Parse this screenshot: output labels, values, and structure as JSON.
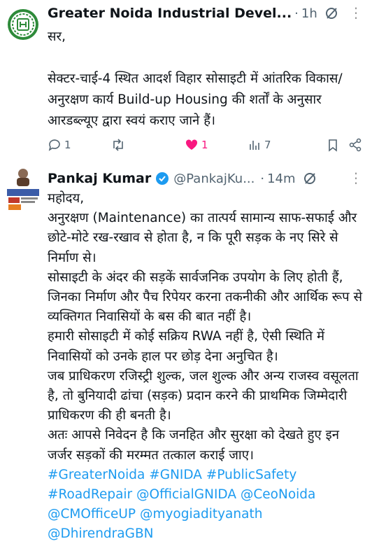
{
  "tweet1": {
    "author": "Greater Noida Industrial Devel...",
    "time": "1h",
    "greeting": "सर,",
    "body": "सेक्टर-चाई-4 स्थित आदर्श विहार सोसाइटी में आंतरिक विकास/अनुरक्षण कार्य Build-up Housing की शर्तों के अनुसार आरडब्ल्यूए द्वारा स्वयं कराए जाने हैं।",
    "actions": {
      "replies": "1",
      "reposts": "",
      "likes": "1",
      "views": "7"
    },
    "colors": {
      "avatar_green": "#2e8b3a",
      "like": "#f91880"
    }
  },
  "tweet2": {
    "author": "Pankaj Kumar",
    "handle": "@PankajKu...",
    "dot": "·",
    "time": "14m",
    "paragraphs": [
      "महोदय,",
      "अनुरक्षण (Maintenance) का तात्पर्य सामान्य साफ-सफाई और छोटे-मोटे रख-रखाव से होता है, न कि पूरी सड़क के नए सिरे से निर्माण से।",
      "सोसाइटी के अंदर की सड़कें सार्वजनिक उपयोग के लिए होती हैं, जिनका निर्माण और पैच रिपेयर करना तकनीकी और आर्थिक रूप से व्यक्तिगत निवासियों के बस की बात नहीं है।",
      "हमारी सोसाइटी में कोई सक्रिय RWA नहीं है, ऐसी स्थिति में निवासियों को उनके हाल पर छोड़ देना अनुचित है।",
      "जब प्राधिकरण रजिस्ट्री शुल्क, जल शुल्क और अन्य राजस्व वसूलता है, तो बुनियादी ढांचा (सड़क) प्रदान करने की प्राथमिक जिम्मेदारी प्राधिकरण की ही बनती है।",
      "अतः आपसे निवेदन है कि जनहित और सुरक्षा को देखते हुए इन जर्जर सड़कों की मरम्मत तत्काल कराई जाए।"
    ],
    "hashtags": [
      "#GreaterNoida #GNIDA #PublicSafety",
      "#RoadRepair @OfficialGNIDA @CeoNoida",
      "@CMOfficeUP @myogiadityanath",
      "@DhirendraGBN"
    ],
    "colors": {
      "link": "#1d9bf0",
      "verified": "#1d9bf0"
    }
  }
}
